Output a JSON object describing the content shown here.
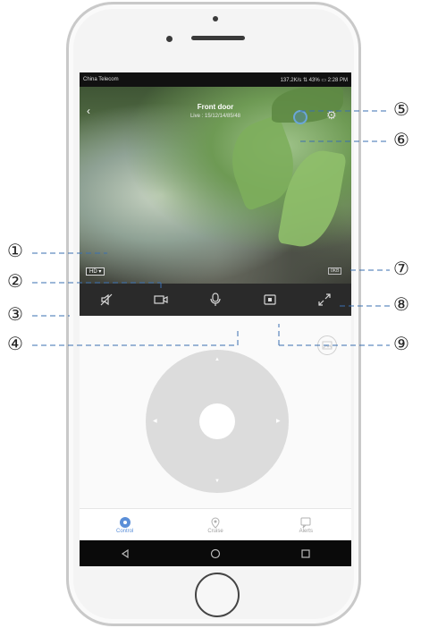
{
  "status_bar": {
    "carrier": "China Telecom",
    "right": "137.2K/s ⇅ 43% ▭ 2:28 PM"
  },
  "camera": {
    "title": "Front door",
    "subtitle": "Live : 15/12/14/85/48",
    "quality_badge": "HD ▾",
    "speed": "0KB"
  },
  "toolbar": {
    "icons": [
      "mute-icon",
      "record-icon",
      "microphone-icon",
      "screenshot-icon",
      "fullscreen-icon"
    ]
  },
  "tabs": [
    {
      "label": "Control",
      "icon": "control-icon",
      "active": true
    },
    {
      "label": "Cruise",
      "icon": "location-pin-icon",
      "active": false
    },
    {
      "label": "Alerts",
      "icon": "alerts-icon",
      "active": false
    }
  ],
  "callouts": [
    "①",
    "②",
    "③",
    "④",
    "⑤",
    "⑥",
    "⑦",
    "⑧",
    "⑨"
  ],
  "colors": {
    "accent": "#5b8fd8",
    "toolbar_bg": "#2a2a2a",
    "pad": "#dcdcdc"
  }
}
